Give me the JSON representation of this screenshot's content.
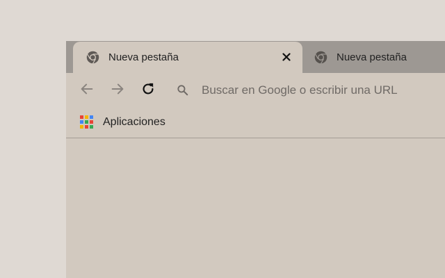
{
  "tabs": [
    {
      "title": "Nueva pestaña",
      "active": true
    },
    {
      "title": "Nueva pestaña",
      "active": false
    }
  ],
  "toolbar": {
    "back_icon": "arrow-left-icon",
    "forward_icon": "arrow-right-icon",
    "reload_icon": "reload-icon"
  },
  "omnibox": {
    "placeholder": "Buscar en Google o escribir una URL",
    "value": "",
    "icon": "search-icon"
  },
  "bookmarks": [
    {
      "label": "Aplicaciones",
      "icon": "apps-grid-icon"
    }
  ],
  "colors": {
    "apps_grid": [
      "#e94235",
      "#f4b400",
      "#4285f4",
      "#4285f4",
      "#34a853",
      "#e94235",
      "#f4b400",
      "#e94235",
      "#34a853"
    ]
  }
}
